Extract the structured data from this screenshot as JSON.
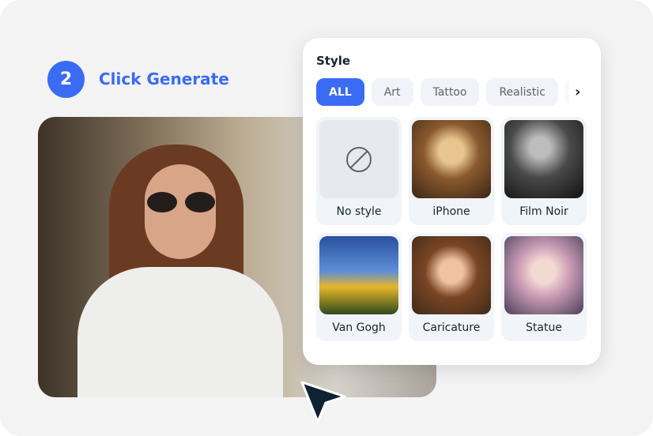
{
  "step": {
    "number": "2",
    "label": "Click Generate"
  },
  "panel": {
    "title": "Style",
    "chips": [
      {
        "label": "ALL",
        "active": true
      },
      {
        "label": "Art"
      },
      {
        "label": "Tattoo"
      },
      {
        "label": "Realistic"
      }
    ],
    "styles": [
      {
        "label": "No style",
        "icon": "no-style-icon"
      },
      {
        "label": "iPhone"
      },
      {
        "label": "Film Noir"
      },
      {
        "label": "Van Gogh"
      },
      {
        "label": "Caricature"
      },
      {
        "label": "Statue"
      }
    ]
  },
  "colors": {
    "accent": "#3a6bf4",
    "text": "#17242e"
  }
}
